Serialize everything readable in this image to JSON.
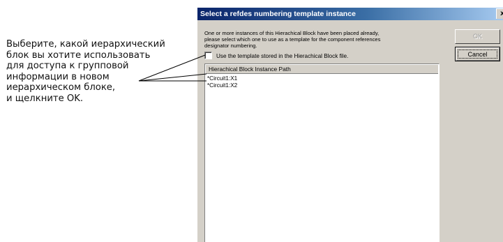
{
  "annotation": {
    "lines": [
      "Выберите, какой иерархический",
      "блок вы хотите использовать",
      "для доступа к групповой",
      "информации в новом",
      "иерархическом блоке,",
      "и щелкните OK."
    ]
  },
  "dialog": {
    "title": "Select a refdes numbering template instance",
    "close_label": "x",
    "description_lines": [
      "One or more instances of this Hierachical Block have been placed already,",
      "please select which one to use as a template for the component references",
      "designator numbering."
    ],
    "ok_label": "OK",
    "cancel_label": "Cancel",
    "checkbox_label": "Use the template stored in the Hierachical Block file.",
    "checkbox_checked": false,
    "list_header": "Hierachical Block Instance Path",
    "instances": [
      "*Circuit1:X1",
      "*Circuit1:X2"
    ]
  },
  "colors": {
    "title_gradient_start": "#0a246a",
    "title_gradient_end": "#a6caf0",
    "window_face": "#d4d0c8"
  }
}
